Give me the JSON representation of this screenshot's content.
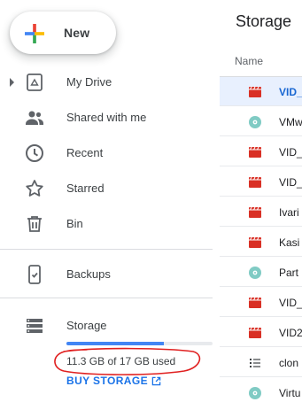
{
  "new_button": {
    "label": "New"
  },
  "nav": [
    {
      "id": "my-drive",
      "label": "My Drive",
      "icon": "drive-icon",
      "expandable": true
    },
    {
      "id": "shared",
      "label": "Shared with me",
      "icon": "people-icon"
    },
    {
      "id": "recent",
      "label": "Recent",
      "icon": "clock-icon"
    },
    {
      "id": "starred",
      "label": "Starred",
      "icon": "star-icon"
    },
    {
      "id": "bin",
      "label": "Bin",
      "icon": "trash-icon"
    },
    {
      "id": "backups",
      "label": "Backups",
      "icon": "backup-device-icon"
    },
    {
      "id": "storage",
      "label": "Storage",
      "icon": "storage-icon"
    }
  ],
  "storage": {
    "used_text": "11.3 GB of 17 GB used",
    "used_fraction": 0.665,
    "buy_label": "BUY STORAGE",
    "annotation_color": "#e02020"
  },
  "main": {
    "title": "Storage",
    "column_name": "Name",
    "rows": [
      {
        "name": "VID_",
        "type": "video",
        "selected": true
      },
      {
        "name": "VMw",
        "type": "disc"
      },
      {
        "name": "VID_",
        "type": "video"
      },
      {
        "name": "VID_",
        "type": "video"
      },
      {
        "name": "Ivari",
        "type": "video"
      },
      {
        "name": "Kasi",
        "type": "video"
      },
      {
        "name": "Part",
        "type": "disc"
      },
      {
        "name": "VID_",
        "type": "video"
      },
      {
        "name": "VID2",
        "type": "video"
      },
      {
        "name": "clon",
        "type": "list"
      },
      {
        "name": "Virtu",
        "type": "disc"
      }
    ]
  },
  "colors": {
    "accent_blue": "#1a73e8",
    "video_red": "#d93025",
    "disc_teal": "#80cbc4",
    "selected_bg": "#e8f0fe"
  }
}
